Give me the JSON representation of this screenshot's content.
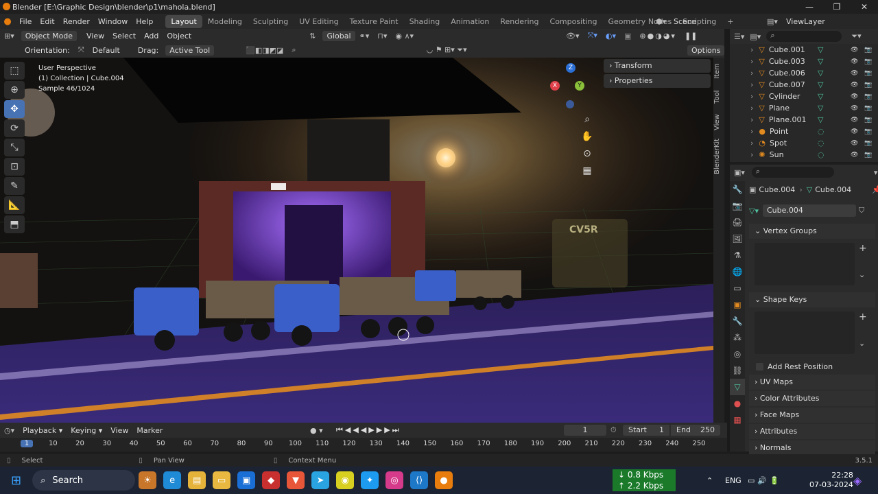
{
  "window": {
    "title": "Blender [E:\\Graphic Design\\blender\\p1\\mahola.blend]",
    "minimize": "—",
    "maximize": "❐",
    "close": "✕"
  },
  "menu": {
    "items": [
      "File",
      "Edit",
      "Render",
      "Window",
      "Help"
    ],
    "workspaces": [
      "Layout",
      "Modeling",
      "Sculpting",
      "UV Editing",
      "Texture Paint",
      "Shading",
      "Animation",
      "Rendering",
      "Compositing",
      "Geometry Nodes",
      "Scripting"
    ],
    "scene": "Scene",
    "view_layer": "ViewLayer"
  },
  "header": {
    "mode": "Object Mode",
    "view": "View",
    "select": "Select",
    "add": "Add",
    "object": "Object",
    "transform": "Global"
  },
  "header2": {
    "orientation_label": "Orientation:",
    "orientation_value": "Default",
    "drag_label": "Drag:",
    "drag_value": "Active Tool",
    "options": "Options"
  },
  "viewport": {
    "perspective": "User Perspective",
    "collection": "(1) Collection | Cube.004",
    "sample": "Sample 46/1024",
    "sign_text": "CV5R",
    "gizmo": {
      "x": "X",
      "y": "Y",
      "z": "Z"
    }
  },
  "npanel": {
    "transform": "Transform",
    "properties": "Properties",
    "tabs": [
      "Item",
      "Tool",
      "View",
      "BlenderKit"
    ]
  },
  "outliner": {
    "items": [
      "Cube.001",
      "Cube.003",
      "Cube.006",
      "Cube.007",
      "Cylinder",
      "Plane",
      "Plane.001",
      "Point",
      "Spot",
      "Sun"
    ]
  },
  "props": {
    "object": "Cube.004",
    "mesh": "Cube.004",
    "data_name": "Cube.004",
    "sections": {
      "vertex_groups": "Vertex Groups",
      "shape_keys": "Shape Keys",
      "add_rest": "Add Rest Position",
      "uv_maps": "UV Maps",
      "color_attributes": "Color Attributes",
      "face_maps": "Face Maps",
      "attributes": "Attributes",
      "normals": "Normals"
    }
  },
  "timeline": {
    "playback": "Playback",
    "keying": "Keying",
    "view": "View",
    "marker": "Marker",
    "current_frame": "1",
    "start_label": "Start",
    "start": "1",
    "end_label": "End",
    "end": "250",
    "ticks": [
      "1",
      "10",
      "20",
      "30",
      "40",
      "50",
      "60",
      "70",
      "80",
      "90",
      "100",
      "110",
      "120",
      "130",
      "140",
      "150",
      "160",
      "170",
      "180",
      "190",
      "200",
      "210",
      "220",
      "230",
      "240",
      "250"
    ]
  },
  "statusbar": {
    "select": "Select",
    "pan": "Pan View",
    "context": "Context Menu",
    "version": "3.5.1"
  },
  "taskbar": {
    "search": "Search",
    "net_down": "0.8 Kbps",
    "net_up": "2.2 Kbps",
    "lang": "ENG",
    "time": "22:28",
    "date": "07-03-2024"
  }
}
